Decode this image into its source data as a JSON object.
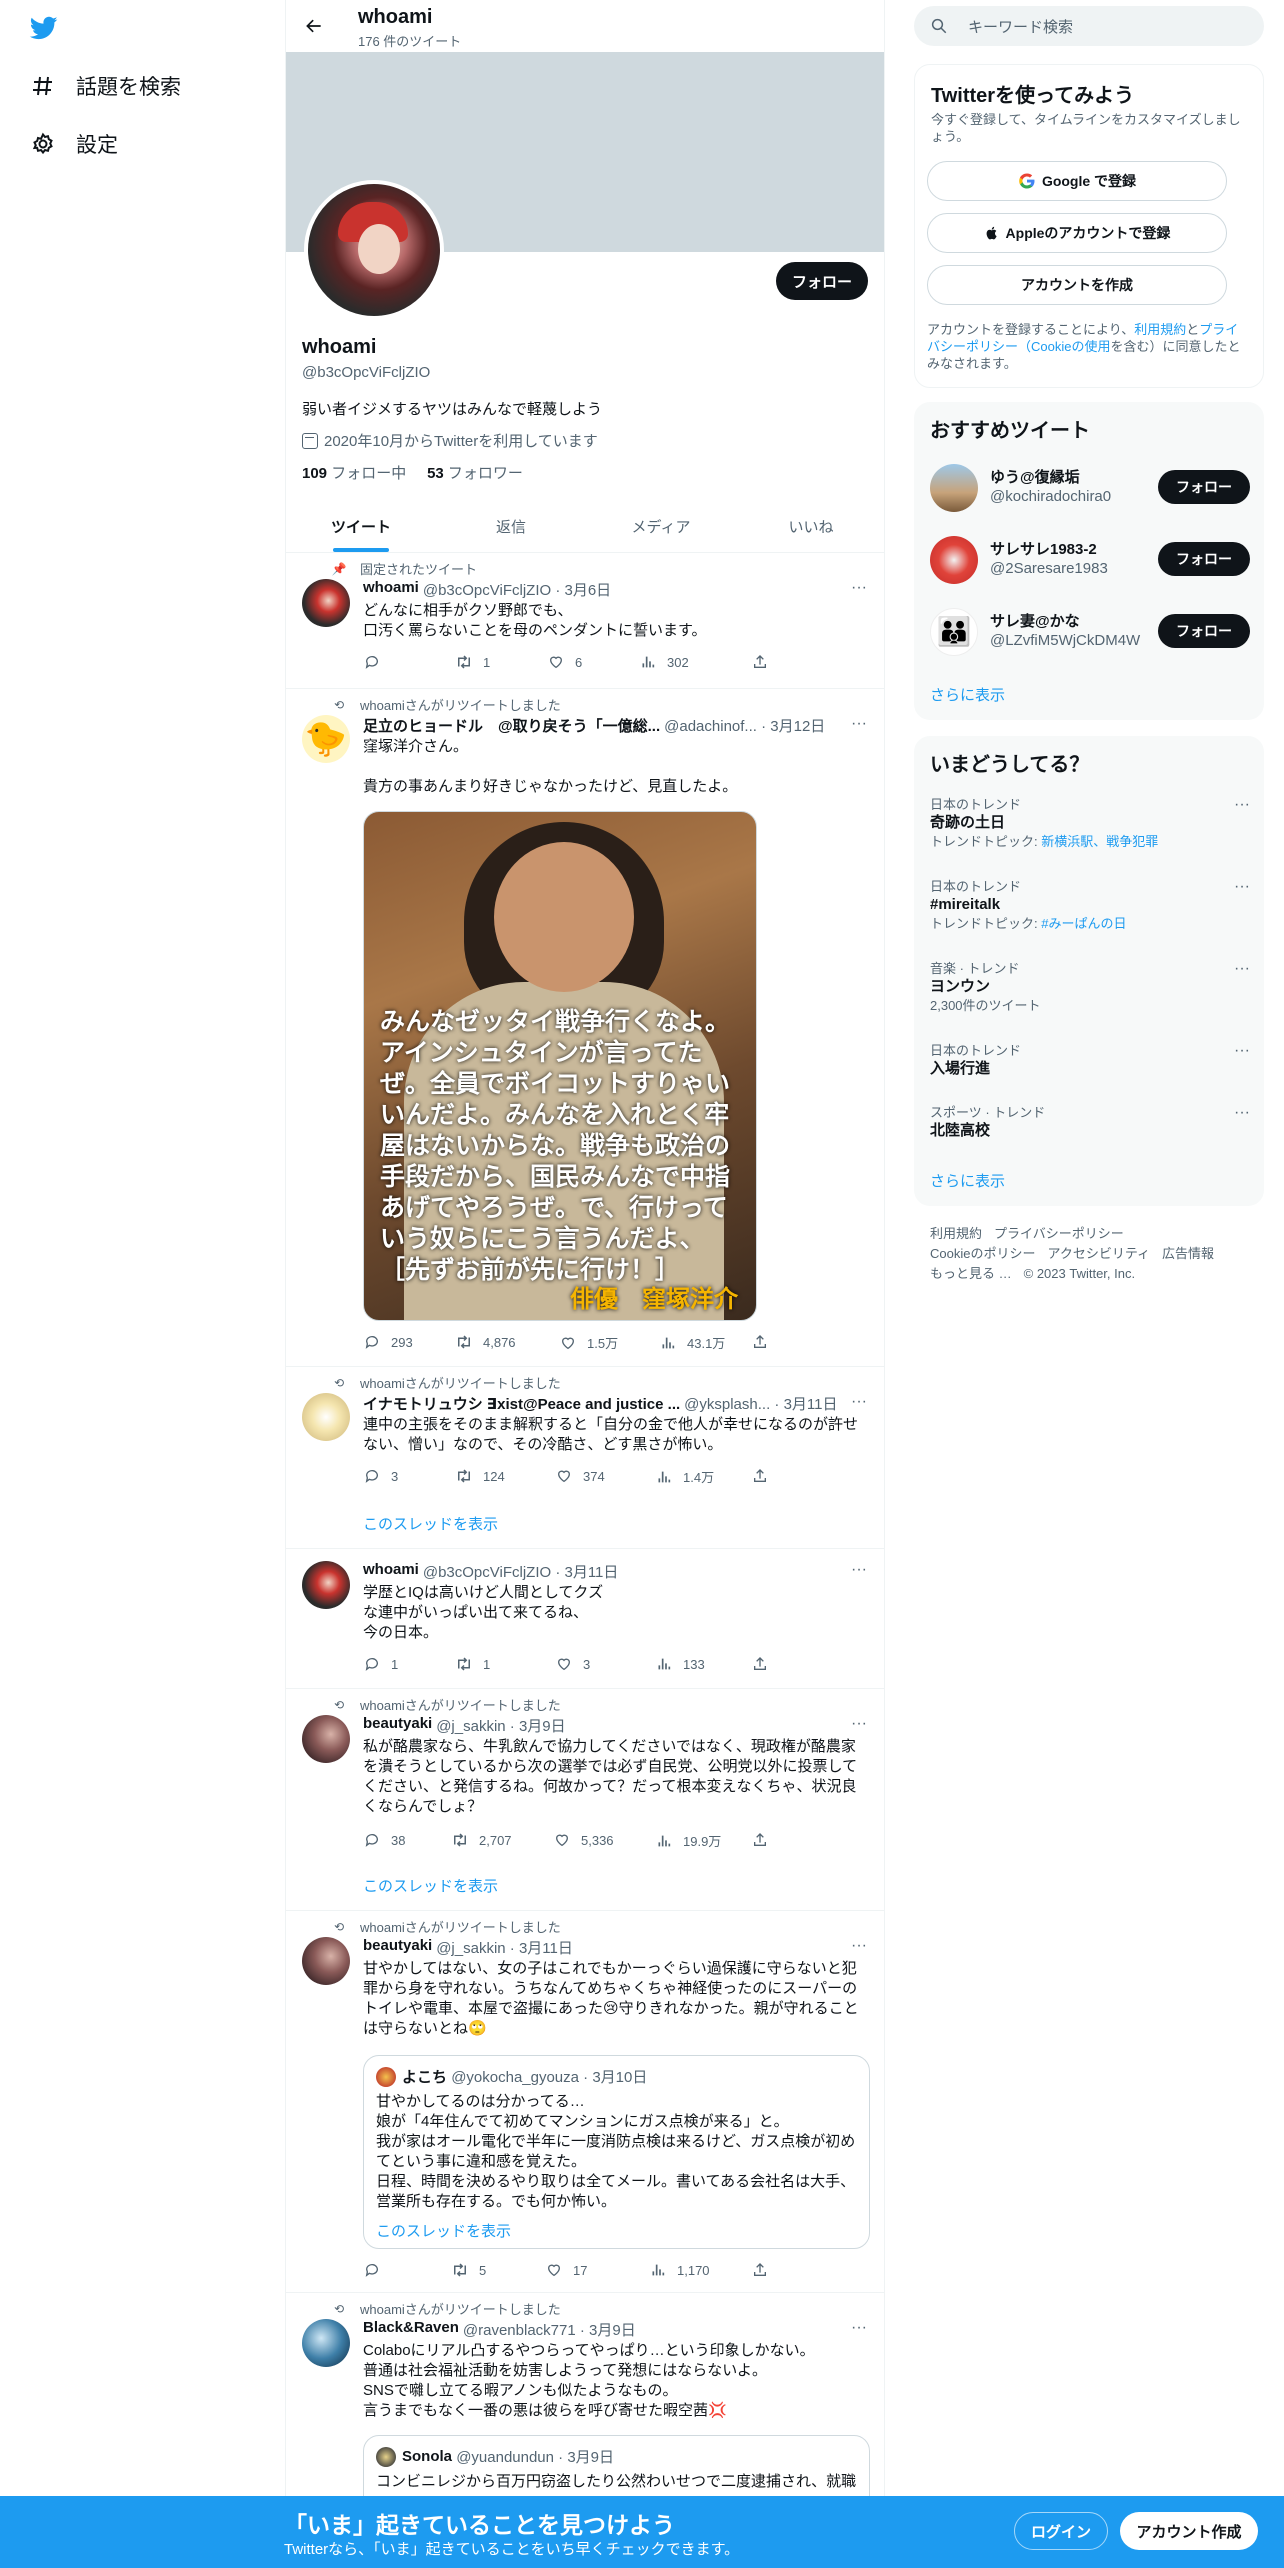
{
  "nav": {
    "explore": "話題を検索",
    "settings": "設定"
  },
  "profile_header": {
    "name": "whoami",
    "tweet_count": "176 件のツイート"
  },
  "profile": {
    "follow_label": "フォロー",
    "name": "whoami",
    "handle": "@b3cOpcViFcljZIO",
    "bio": "弱い者イジメするヤツはみんなで軽蔑しよう",
    "joined": "2020年10月からTwitterを利用しています",
    "following_count": "109",
    "following_label": "フォロー中",
    "followers_count": "53",
    "followers_label": "フォロワー"
  },
  "tabs": [
    "ツイート",
    "返信",
    "メディア",
    "いいね"
  ],
  "tweets": [
    {
      "context": "固定されたツイート",
      "name": "whoami",
      "meta": "@b3cOpcViFcljZIO · 3月6日",
      "text": "どんなに相手がクソ野郎でも、\n口汚く罵らないことを母のペンダントに誓います。",
      "reply": "",
      "retweet": "1",
      "like": "6",
      "views": "302"
    },
    {
      "context": "whoamiさんがリツイートしました",
      "name": "足立のヒョードル　@取り戻そう「一億総...",
      "meta": "@adachinof... · 3月12日",
      "text": "窪塚洋介さん。\n\n貴方の事あんまり好きじゃなかったけど、見直したよ。",
      "image_caption": "みんなゼッタイ戦争行くなよ。\nアインシュタインが言ってた\nぜ。全員でボイコットすりゃい\nいんだよ。みんなを入れとく牢\n屋はないからな。戦争も政治の\n手段だから、国民みんなで中指\nあげてやろうぜ。で、行けって\nいう奴らにこう言うんだよ、\n［先ずお前が先に行け！］",
      "image_credit": "俳優　窪塚洋介",
      "reply": "293",
      "retweet": "4,876",
      "like": "1.5万",
      "views": "43.1万"
    },
    {
      "context": "whoamiさんがリツイートしました",
      "name": "イナモトリュウシ ∃xist@Peace and justice ...",
      "meta": "@yksplash... · 3月11日",
      "text": "連中の主張をそのまま解釈すると「自分の金で他人が幸せになるのが許せない、憎い」なので、その冷酷さ、どす黒さが怖い。",
      "reply": "3",
      "retweet": "124",
      "like": "374",
      "views": "1.4万",
      "thread": "このスレッドを表示"
    },
    {
      "context": "",
      "name": "whoami",
      "meta": "@b3cOpcViFcljZIO · 3月11日",
      "text": "学歴とIQは高いけど人間としてクズ\nな連中がいっぱい出て来てるね、\n今の日本。",
      "reply": "1",
      "retweet": "1",
      "like": "3",
      "views": "133"
    },
    {
      "context": "whoamiさんがリツイートしました",
      "name": "beautyaki",
      "meta": "@j_sakkin · 3月9日",
      "text": "私が酪農家なら、牛乳飲んで協力してくださいではなく、現政権が酪農家を潰そうとしているから次の選挙では必ず自民党、公明党以外に投票してください、と発信するね。何故かって？だって根本変えなくちゃ、状況良くならんでしょ？",
      "reply": "38",
      "retweet": "2,707",
      "like": "5,336",
      "views": "19.9万",
      "thread": "このスレッドを表示"
    },
    {
      "context": "whoamiさんがリツイートしました",
      "name": "beautyaki",
      "meta": "@j_sakkin · 3月11日",
      "text": "甘やかしてはない、女の子はこれでもかーっぐらい過保護に守らないと犯罪から身を守れない。うちなんてめちゃくちゃ神経使ったのにスーパーのトイレや電車、本屋で盗撮にあった😢守りきれなかった。親が守れることは守らないとね🙄",
      "quote_name": "よこち",
      "quote_meta": "@yokocha_gyouza · 3月10日",
      "quote_text": "甘やかしてるのは分かってる…\n娘が「4年住んでて初めてマンションにガス点検が来る」と。\n我が家はオール電化で半年に一度消防点検は来るけど、ガス点検が初めてという事に違和感を覚えた。\n日程、時間を決めるやり取りは全てメール。書いてある会社名は大手、営業所も存在する。でも何か怖い。",
      "quote_thread": "このスレッドを表示",
      "reply": "",
      "retweet": "5",
      "like": "17",
      "views": "1,170"
    },
    {
      "context": "whoamiさんがリツイートしました",
      "name": "Black&Raven",
      "meta": "@ravenblack771 · 3月9日",
      "text": "Colaboにリアル凸するやつらってやっぱり…という印象しかない。\n普通は社会福祉活動を妨害しようって発想にはならないよ。\nSNSで囃し立てる暇アノンも似たようなもの。\n言うまでもなく一番の悪は彼らを呼び寄せた暇空茜💢",
      "quote_name": "Sonola",
      "quote_meta": "@yuandundun · 3月9日",
      "quote_text": "コンビニレジから百万円窃盗したり公然わいせつで二度逮捕され、就職"
    }
  ],
  "search": {
    "placeholder": "キーワード検索"
  },
  "signup": {
    "title": "Twitterを使ってみよう",
    "subtitle": "今すぐ登録して、タイムラインをカスタマイズしましょう。",
    "google": "Google で登録",
    "apple": "Appleのアカウントで登録",
    "create": "アカウントを作成",
    "terms_pre": "アカウントを登録することにより、",
    "terms_link1": "利用規約",
    "terms_mid": "と",
    "terms_link2": "プライバシーポリシー（Cookieの使用",
    "terms_post": "を含む）に同意したとみなされます。"
  },
  "recommend": {
    "title": "おすすめツイート",
    "users": [
      {
        "name": "ゆう@復縁垢",
        "handle": "@kochiradochira0",
        "follow": "フォロー"
      },
      {
        "name": "サレサレ1983-2",
        "handle": "@2Saresare1983",
        "follow": "フォロー"
      },
      {
        "name": "サレ妻@かな",
        "handle": "@LZvfiM5WjCkDM4W",
        "follow": "フォロー"
      }
    ],
    "more": "さらに表示"
  },
  "trends": {
    "title": "いまどうしてる？",
    "items": [
      {
        "category": "日本のトレンド",
        "title": "奇跡の土日",
        "sub_prefix": "トレンドトピック: ",
        "sub_links": "新横浜駅、戦争犯罪"
      },
      {
        "category": "日本のトレンド",
        "title": "#mireitalk",
        "sub_prefix": "トレンドトピック: ",
        "sub_links": "#みーぱんの日"
      },
      {
        "category": "音楽 · トレンド",
        "title": "ヨンウン",
        "sub_prefix": "2,300件のツイート",
        "sub_links": ""
      },
      {
        "category": "日本のトレンド",
        "title": "入場行進",
        "sub_prefix": "",
        "sub_links": ""
      },
      {
        "category": "スポーツ · トレンド",
        "title": "北陸高校",
        "sub_prefix": "",
        "sub_links": ""
      }
    ],
    "more": "さらに表示"
  },
  "footer": {
    "terms": "利用規約",
    "privacy": "プライバシーポリシー",
    "cookie": "Cookieのポリシー",
    "accessibility": "アクセシビリティ",
    "ads": "広告情報",
    "more": "もっと見る …",
    "copyright": "© 2023 Twitter, Inc."
  },
  "bottom_bar": {
    "title": "「いま」起きていることを見つけよう",
    "subtitle": "Twitterなら、「いま」起きていることをいち早くチェックできます。",
    "login": "ログイン",
    "signup": "アカウント作成"
  },
  "colors": {
    "accent": "#1d9bf0",
    "text": "#0f1419",
    "muted": "#536471"
  }
}
